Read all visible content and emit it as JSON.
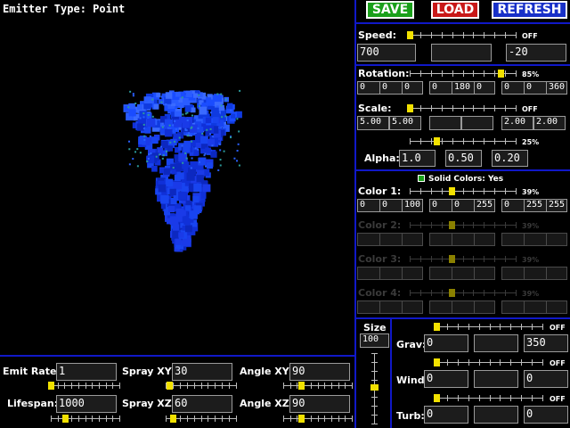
{
  "viewport": {
    "title": "Emitter Type: Point"
  },
  "toolbar": {
    "save": "SAVE",
    "load": "LOAD",
    "refresh": "REFRESH"
  },
  "speed": {
    "label": "Speed:",
    "pct": "OFF",
    "value": 0.0,
    "fields": [
      "700",
      "",
      "-20"
    ]
  },
  "rotation": {
    "label": "Rotation:",
    "pct": "85%",
    "value": 0.85,
    "fields": [
      "0",
      "0",
      "0",
      "0",
      "180",
      "0",
      "0",
      "0",
      "360"
    ]
  },
  "scale": {
    "label": "Scale:",
    "pct": "OFF",
    "value": 0.0,
    "fields": [
      "5.00",
      "5.00",
      "",
      "",
      "2.00",
      "2.00"
    ]
  },
  "alpha": {
    "label": "Alpha:",
    "pct": "25%",
    "value": 0.25,
    "fields": [
      "1.0",
      "0.50",
      "0.20"
    ]
  },
  "solid_colors": {
    "label": "Solid Colors: Yes"
  },
  "colors": [
    {
      "label": "Color 1:",
      "pct": "39%",
      "value": 0.39,
      "enabled": true,
      "fields": [
        "0",
        "0",
        "100",
        "0",
        "0",
        "255",
        "0",
        "255",
        "255"
      ]
    },
    {
      "label": "Color 2:",
      "pct": "39%",
      "value": 0.39,
      "enabled": false,
      "fields": [
        "",
        "",
        "",
        "",
        "",
        "",
        "",
        "",
        ""
      ]
    },
    {
      "label": "Color 3:",
      "pct": "39%",
      "value": 0.39,
      "enabled": false,
      "fields": [
        "",
        "",
        "",
        "",
        "",
        "",
        "",
        "",
        ""
      ]
    },
    {
      "label": "Color 4:",
      "pct": "39%",
      "value": 0.39,
      "enabled": false,
      "fields": [
        "",
        "",
        "",
        "",
        "",
        "",
        "",
        "",
        ""
      ]
    }
  ],
  "size": {
    "label": "Size",
    "value": "100",
    "level": 0.48
  },
  "forces": [
    {
      "label": "Grav:",
      "pct": "OFF",
      "value": 0.0,
      "fields": [
        "0",
        "",
        "350"
      ]
    },
    {
      "label": "Wind:",
      "pct": "OFF",
      "value": 0.0,
      "fields": [
        "0",
        "",
        "0"
      ]
    },
    {
      "label": "Turb:",
      "pct": "OFF",
      "value": 0.0,
      "fields": [
        "0",
        "",
        "0"
      ]
    }
  ],
  "bottom": {
    "emit_rate": {
      "label": "Emit Rate:",
      "value": "1",
      "level": 0.0
    },
    "lifespan": {
      "label": "Lifespan:",
      "value": "1000",
      "level": 0.2
    },
    "spray_xy": {
      "label": "Spray XY:",
      "value": "30",
      "level": 0.05
    },
    "spray_xz": {
      "label": "Spray XZ:",
      "value": "60",
      "level": 0.1
    },
    "angle_xy": {
      "label": "Angle XY:",
      "value": "90",
      "level": 0.25
    },
    "angle_xz": {
      "label": "Angle XZ:",
      "value": "90",
      "level": 0.25
    }
  },
  "colors_theme": {
    "accent": "#1018c8",
    "knob": "#f2e100",
    "save": "#1aa01a",
    "load": "#c81818",
    "refresh": "#1830c8",
    "particle": "#1a4cff"
  }
}
